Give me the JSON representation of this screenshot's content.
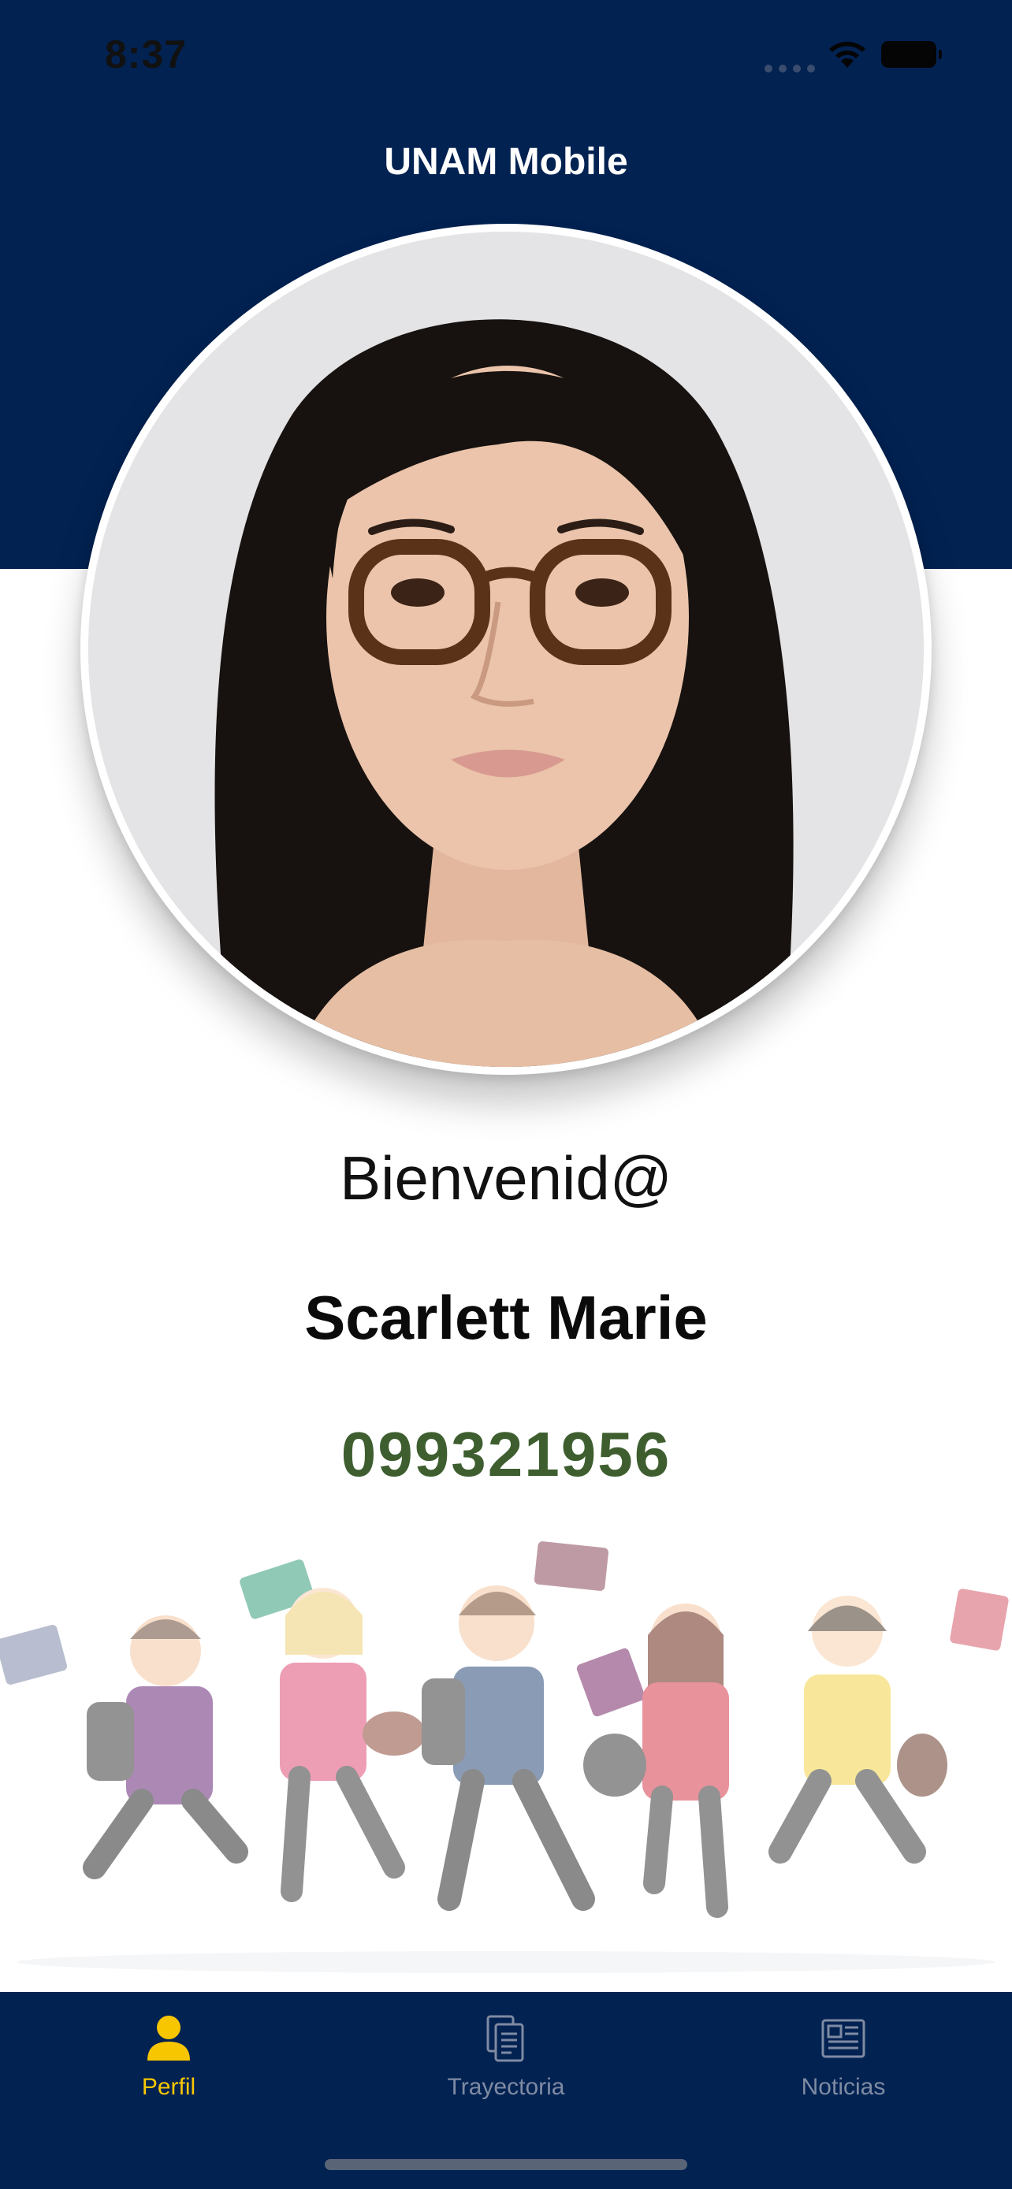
{
  "status_bar": {
    "time": "8:37"
  },
  "header": {
    "title": "UNAM Mobile"
  },
  "profile": {
    "greeting": "Bienvenid@",
    "name": "Scarlett Marie",
    "account_number": "099321956"
  },
  "tabs": [
    {
      "label": "Perfil",
      "icon": "person-icon",
      "selected": true
    },
    {
      "label": "Trayectoria",
      "icon": "document-icon",
      "selected": false
    },
    {
      "label": "Noticias",
      "icon": "newspaper-icon",
      "selected": false
    }
  ],
  "colors": {
    "header_bg": "#022252",
    "tab_active": "#F7C600",
    "tab_inactive": "#7F8BA3",
    "account_number": "#3E5E2F"
  }
}
